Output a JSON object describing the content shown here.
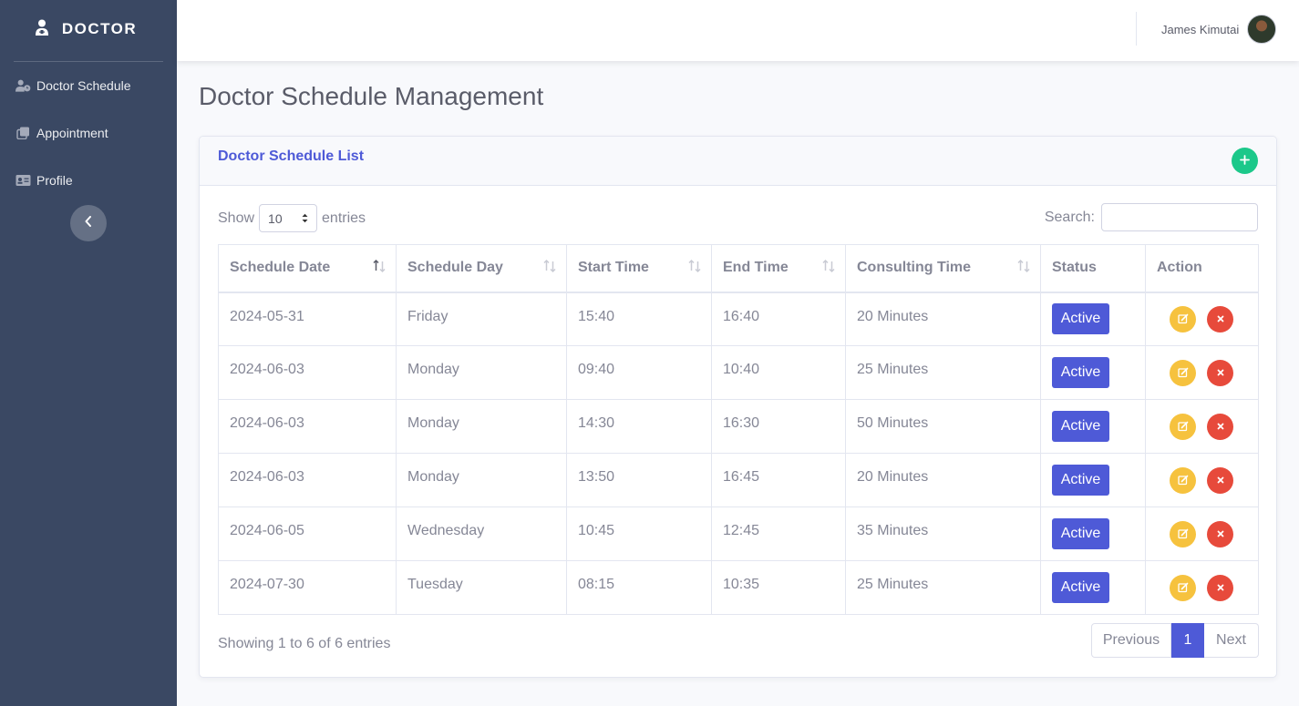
{
  "sidebar": {
    "brand": "DOCTOR",
    "items": [
      {
        "label": "Doctor Schedule",
        "icon": "user-clock-icon"
      },
      {
        "label": "Appointment",
        "icon": "clone-icon"
      },
      {
        "label": "Profile",
        "icon": "id-card-icon"
      }
    ],
    "toggle_icon": "chevron-left-icon"
  },
  "topbar": {
    "user_name": "James Kimutai",
    "avatar": "user-avatar"
  },
  "page": {
    "title": "Doctor Schedule Management"
  },
  "card": {
    "title": "Doctor Schedule List",
    "add_icon": "plus-icon"
  },
  "table_controls": {
    "show_label": "Show",
    "entries_value": "10",
    "entries_label": "entries",
    "search_label": "Search:",
    "search_value": ""
  },
  "table": {
    "headers": [
      "Schedule Date",
      "Schedule Day",
      "Start Time",
      "End Time",
      "Consulting Time",
      "Status",
      "Action"
    ],
    "rows": [
      {
        "date": "2024-05-31",
        "day": "Friday",
        "start": "15:40",
        "end": "16:40",
        "consult": "20 Minutes",
        "status": "Active"
      },
      {
        "date": "2024-06-03",
        "day": "Monday",
        "start": "09:40",
        "end": "10:40",
        "consult": "25 Minutes",
        "status": "Active"
      },
      {
        "date": "2024-06-03",
        "day": "Monday",
        "start": "14:30",
        "end": "16:30",
        "consult": "50 Minutes",
        "status": "Active"
      },
      {
        "date": "2024-06-03",
        "day": "Monday",
        "start": "13:50",
        "end": "16:45",
        "consult": "20 Minutes",
        "status": "Active"
      },
      {
        "date": "2024-06-05",
        "day": "Wednesday",
        "start": "10:45",
        "end": "12:45",
        "consult": "35 Minutes",
        "status": "Active"
      },
      {
        "date": "2024-07-30",
        "day": "Tuesday",
        "start": "08:15",
        "end": "10:35",
        "consult": "25 Minutes",
        "status": "Active"
      }
    ]
  },
  "footer": {
    "info": "Showing 1 to 6 of 6 entries",
    "prev": "Previous",
    "current": "1",
    "next": "Next"
  },
  "colors": {
    "sidebar_bg": "#3a4863",
    "primary": "#4e5ad7",
    "success": "#1cc88a",
    "warning": "#f6c23e",
    "danger": "#e74a3b"
  }
}
